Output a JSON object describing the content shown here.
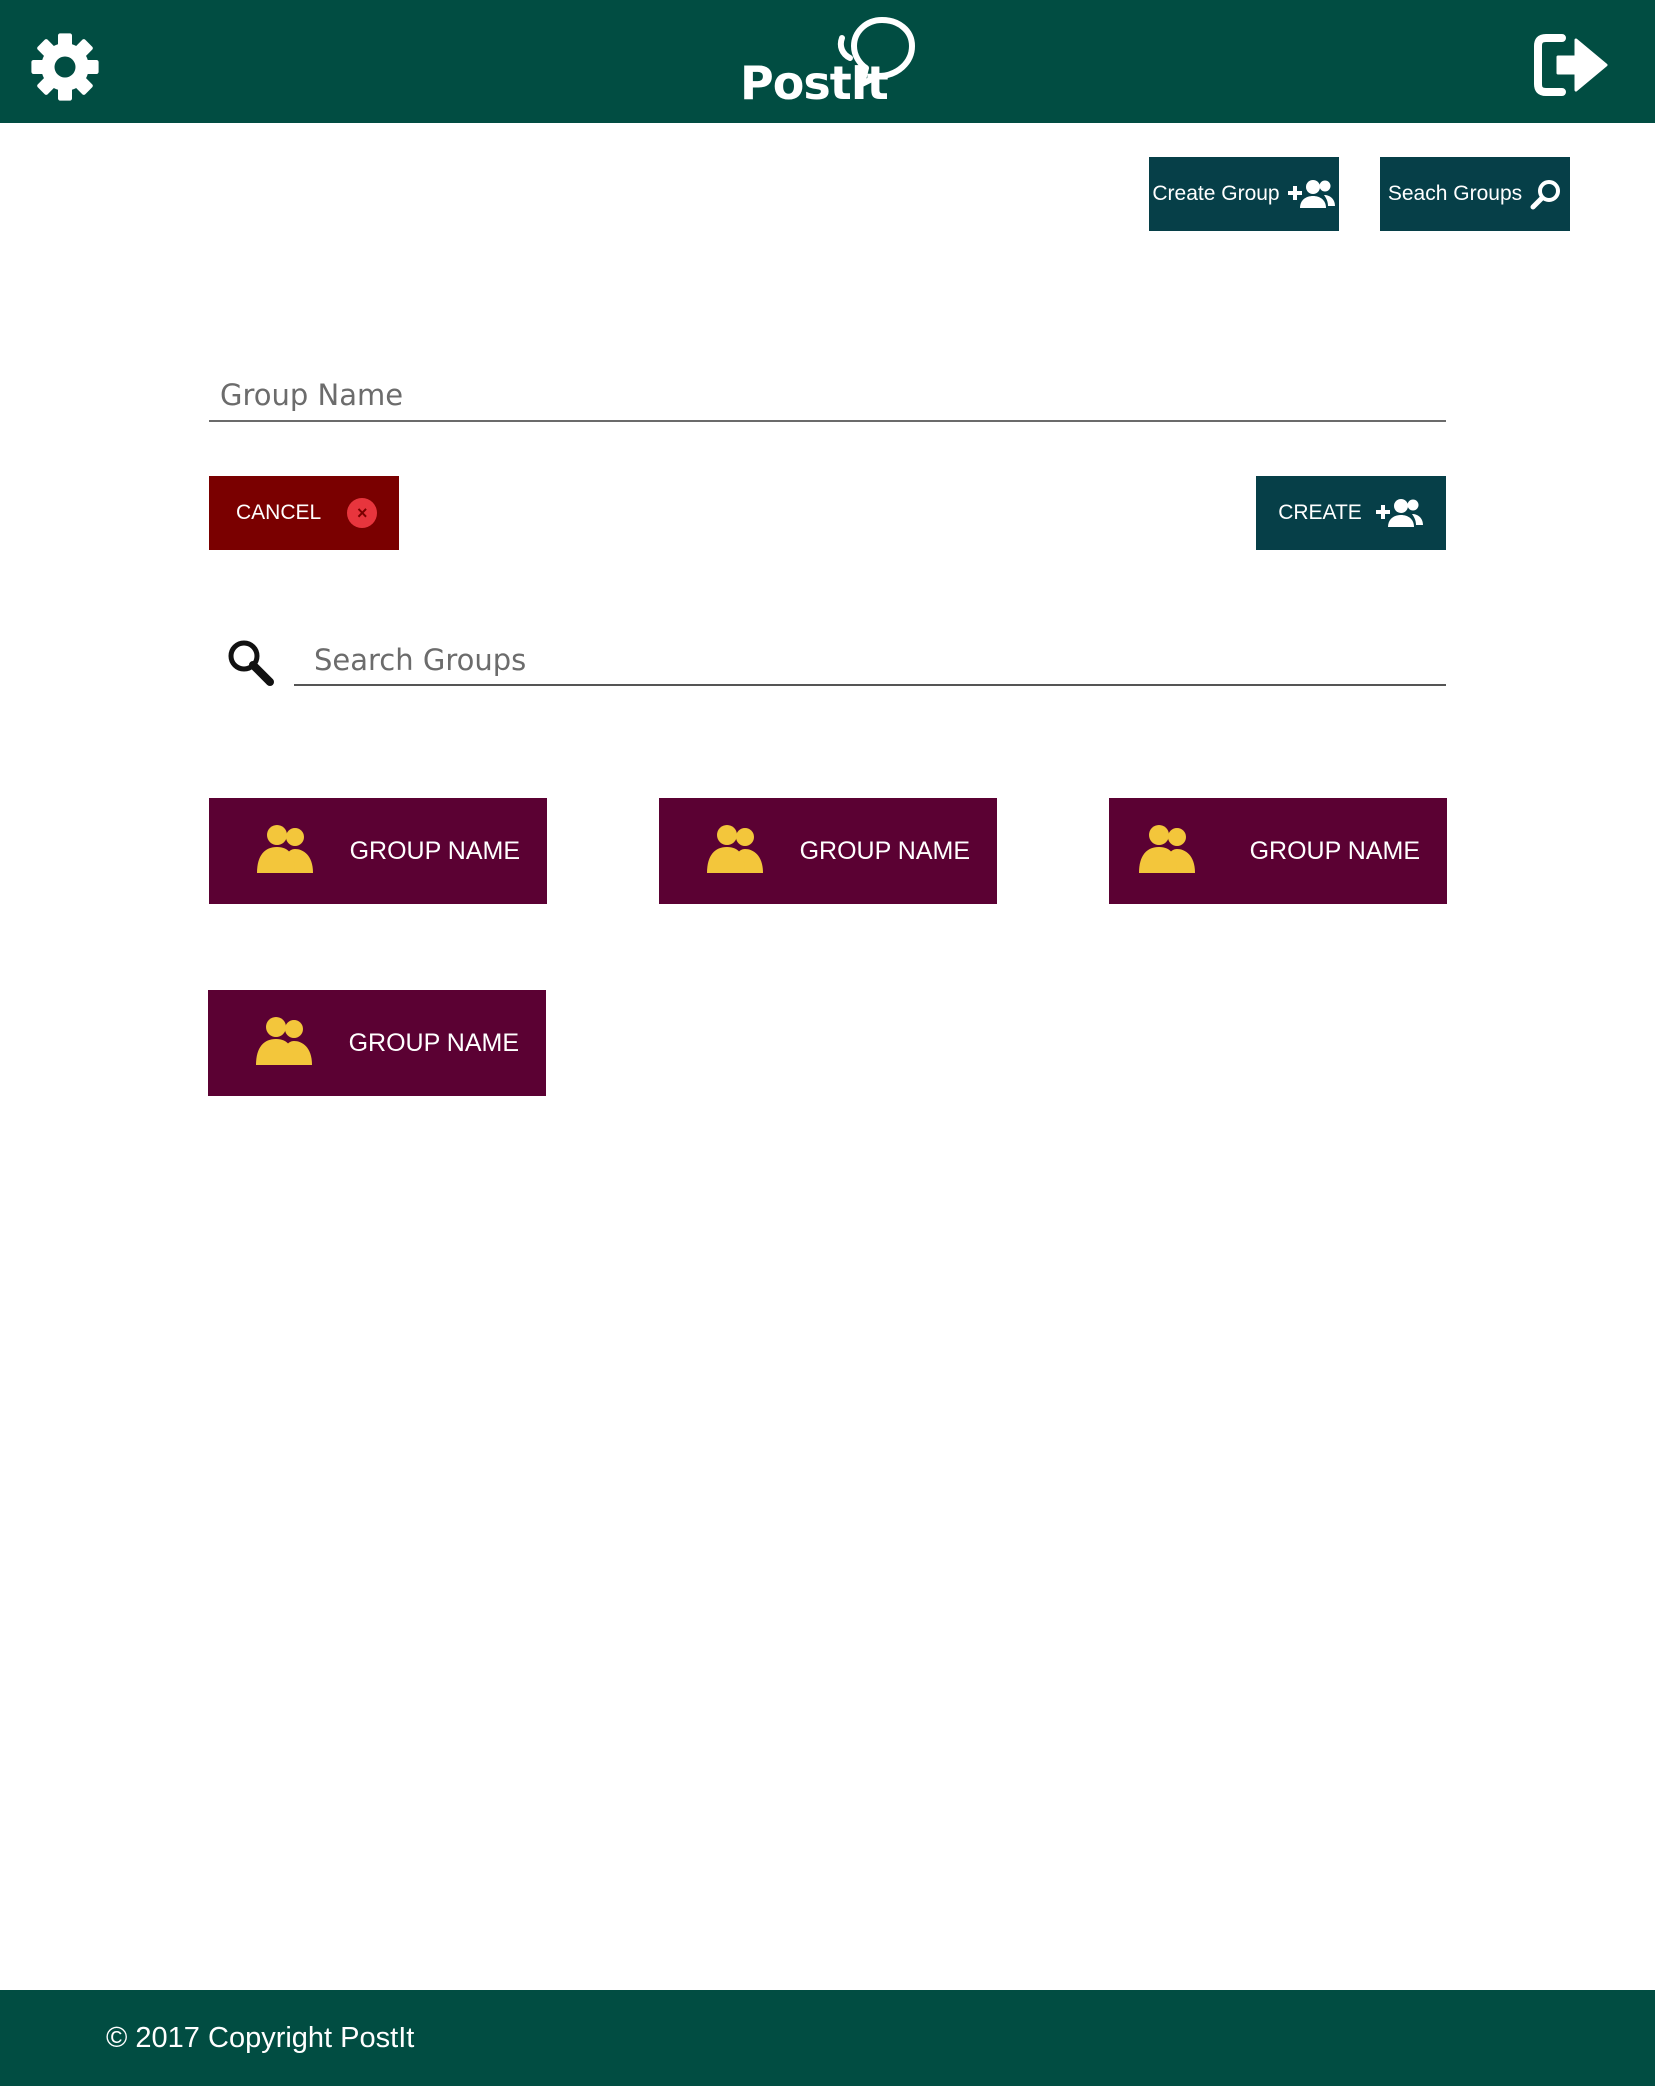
{
  "header": {
    "settings_icon": "gear-icon",
    "logo_text": "PostIt",
    "logo_icon": "chat-bubbles-icon",
    "logout_icon": "logout-icon",
    "background_color": "#014d42"
  },
  "toolbar": {
    "create_group_label": "Create Group",
    "create_group_icon": "add-group-icon",
    "search_groups_label": "Seach Groups",
    "search_groups_icon": "search-icon",
    "button_color": "#063f48"
  },
  "create_form": {
    "group_name_placeholder": "Group Name",
    "group_name_value": "",
    "cancel_label": "CANCEL",
    "cancel_icon": "close-circle-icon",
    "cancel_color": "#7a0000",
    "create_label": "CREATE",
    "create_icon": "add-group-icon"
  },
  "search": {
    "icon": "magnifier-icon",
    "placeholder": "Search Groups",
    "value": ""
  },
  "groups": {
    "card_color": "#5b0133",
    "icon_color": "#f3c63b",
    "items": [
      {
        "label": "GROUP NAME",
        "icon": "users-icon"
      },
      {
        "label": "GROUP NAME",
        "icon": "users-icon"
      },
      {
        "label": "GROUP NAME",
        "icon": "users-icon"
      },
      {
        "label": "GROUP NAME",
        "icon": "users-icon"
      }
    ]
  },
  "footer": {
    "copyright": "© 2017 Copyright PostIt"
  }
}
